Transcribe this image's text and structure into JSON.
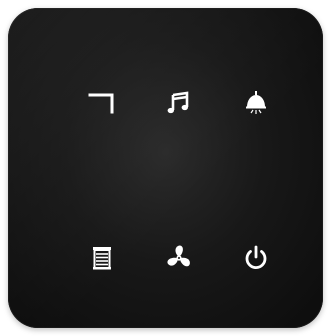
{
  "panel": {
    "keys": [
      {
        "id": "corner",
        "icon": "corner-bracket-icon"
      },
      {
        "id": "music",
        "icon": "music-note-icon"
      },
      {
        "id": "lamp",
        "icon": "ceiling-lamp-icon"
      },
      {
        "id": "blind",
        "icon": "window-blind-icon"
      },
      {
        "id": "fan",
        "icon": "fan-icon"
      },
      {
        "id": "power",
        "icon": "power-icon"
      }
    ],
    "colors": {
      "panel_background": "#121212",
      "icon": "#ffffff"
    }
  }
}
